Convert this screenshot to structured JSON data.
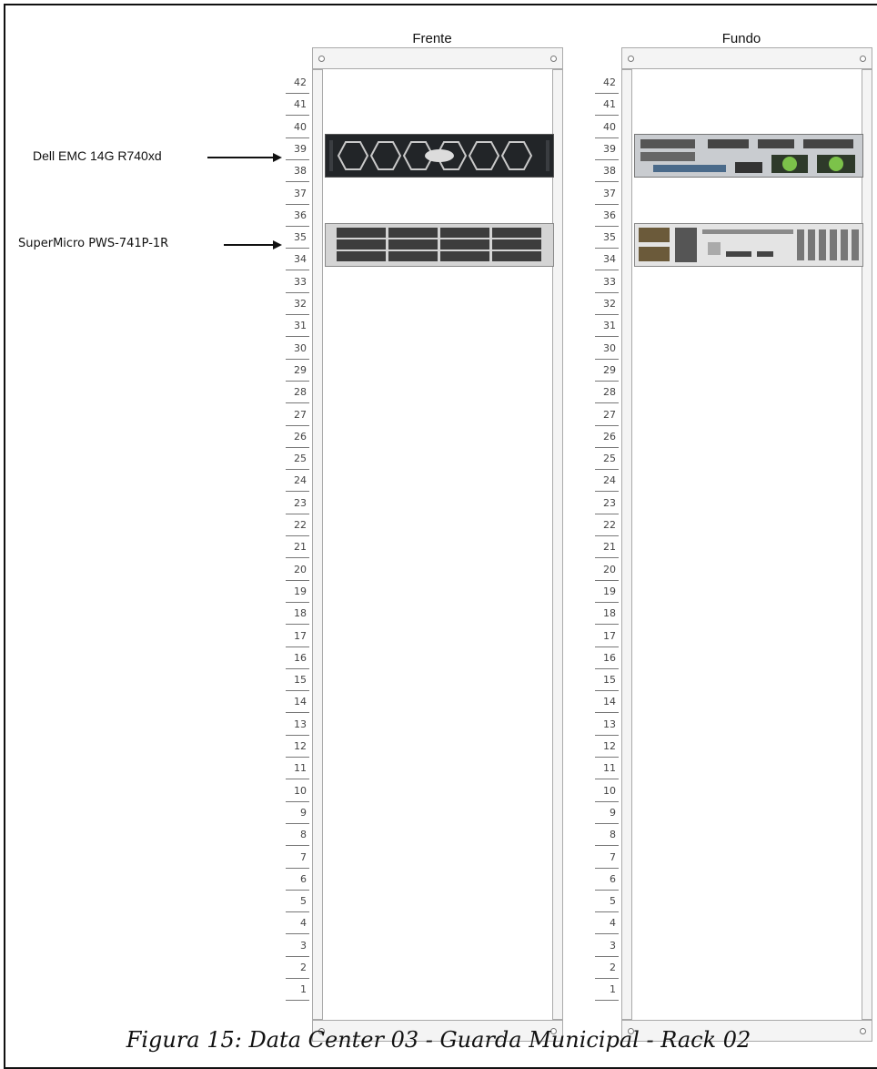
{
  "racks": {
    "front": {
      "title": "Frente"
    },
    "back": {
      "title": "Fundo"
    }
  },
  "units": [
    "42",
    "41",
    "40",
    "39",
    "38",
    "37",
    "36",
    "35",
    "34",
    "33",
    "32",
    "31",
    "30",
    "29",
    "28",
    "27",
    "26",
    "25",
    "24",
    "23",
    "22",
    "21",
    "20",
    "19",
    "18",
    "17",
    "16",
    "15",
    "14",
    "13",
    "12",
    "11",
    "10",
    "9",
    "8",
    "7",
    "6",
    "5",
    "4",
    "3",
    "2",
    "1"
  ],
  "devices": [
    {
      "label": "Dell EMC 14G R740xd",
      "units": [
        "39",
        "38"
      ]
    },
    {
      "label": "SuperMicro PWS-741P-1R",
      "units": [
        "35",
        "34"
      ]
    }
  ],
  "caption": "Figura 15: Data Center 03 - Guarda Municipal - Rack 02"
}
